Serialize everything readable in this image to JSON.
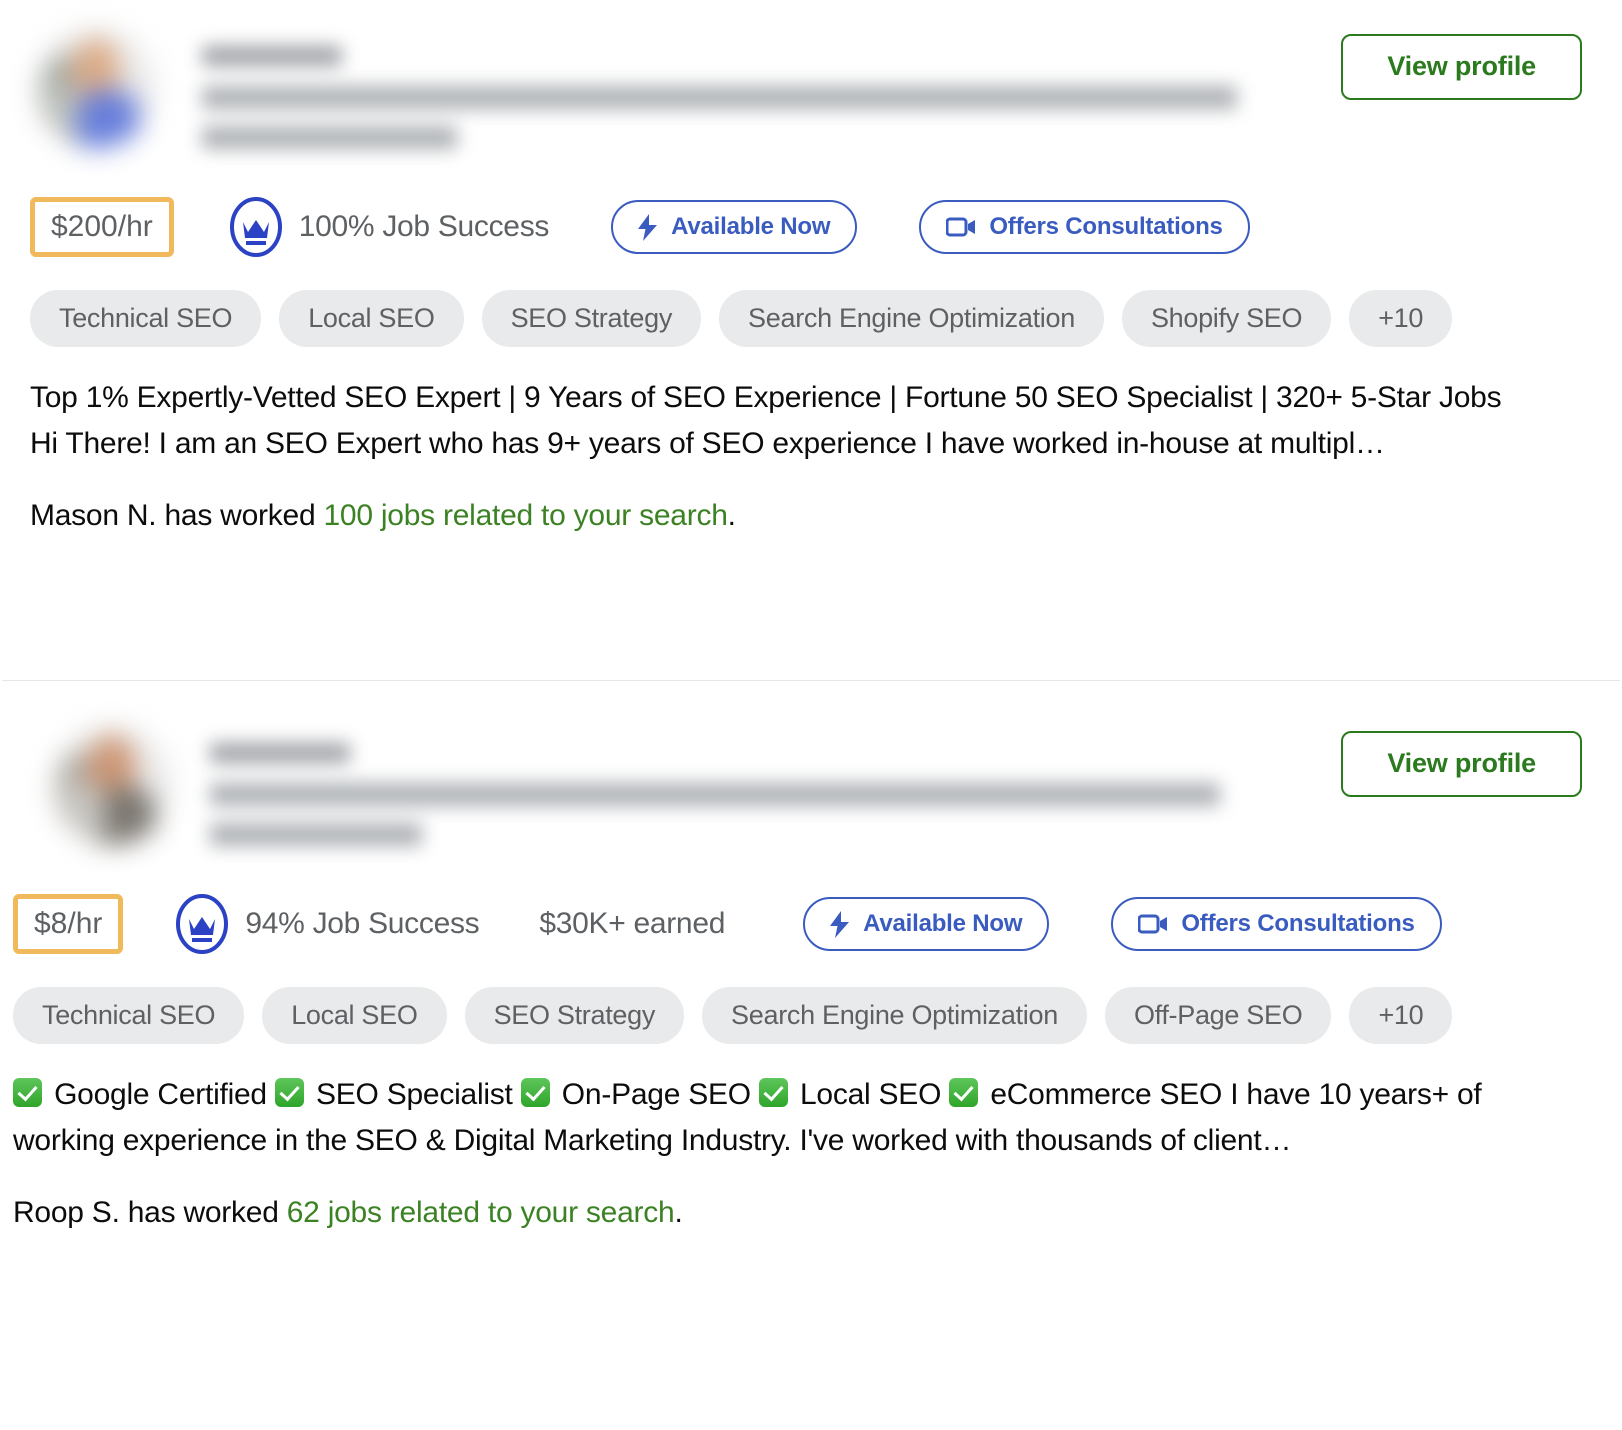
{
  "colors": {
    "green_accent": "#2b7a1e",
    "jobs_link_green": "#3c8224",
    "blue_accent": "#3a5bbf",
    "rate_highlight": "#f0b95c",
    "tag_bg": "#e9eaeb",
    "text_muted": "#5e6164"
  },
  "cards": [
    {
      "view_profile_label": "View profile",
      "rate": "$200/hr",
      "job_success": "100% Job Success",
      "earned": null,
      "available_now_label": "Available Now",
      "offers_consultations_label": "Offers Consultations",
      "tags": [
        "Technical SEO",
        "Local SEO",
        "SEO Strategy",
        "Search Engine Optimization",
        "Shopify SEO",
        "+10"
      ],
      "description": "Top 1% Expertly-Vetted SEO Expert | 9 Years of SEO Experience | Fortune 50 SEO Specialist | 320+ 5-Star Jobs Hi There! I am an SEO Expert who has 9+ years of SEO experience I have worked in-house at multipl…",
      "description_checks": [],
      "jobs_prefix": "Mason N. has worked ",
      "jobs_link": "100 jobs related to your search",
      "jobs_suffix": "."
    },
    {
      "view_profile_label": "View profile",
      "rate": "$8/hr",
      "job_success": "94% Job Success",
      "earned": "$30K+ earned",
      "available_now_label": "Available Now",
      "offers_consultations_label": "Offers Consultations",
      "tags": [
        "Technical SEO",
        "Local SEO",
        "SEO Strategy",
        "Search Engine Optimization",
        "Off-Page SEO",
        "+10"
      ],
      "description": "Google Certified ✅ SEO Specialist ✅ On-Page SEO ✅ Local SEO ✅ eCommerce SEO I have 10 years+ of working experience in the SEO & Digital Marketing Industry. I've worked with thousands of client…",
      "description_segments": [
        {
          "check": true,
          "text": " Google Certified "
        },
        {
          "check": true,
          "text": " SEO Specialist "
        },
        {
          "check": true,
          "text": " On-Page SEO "
        },
        {
          "check": true,
          "text": " Local SEO "
        },
        {
          "check": true,
          "text": " eCommerce SEO I have 10 years+ of working experience in the SEO & Digital Marketing Industry. I've worked with thousands of client…"
        }
      ],
      "jobs_prefix": "Roop S. has worked ",
      "jobs_link": "62 jobs related to your search",
      "jobs_suffix": "."
    }
  ],
  "icons": {
    "crown": "crown-icon",
    "bolt": "bolt-icon",
    "video": "video-camera-icon",
    "check": "white-check-mark-emoji"
  }
}
